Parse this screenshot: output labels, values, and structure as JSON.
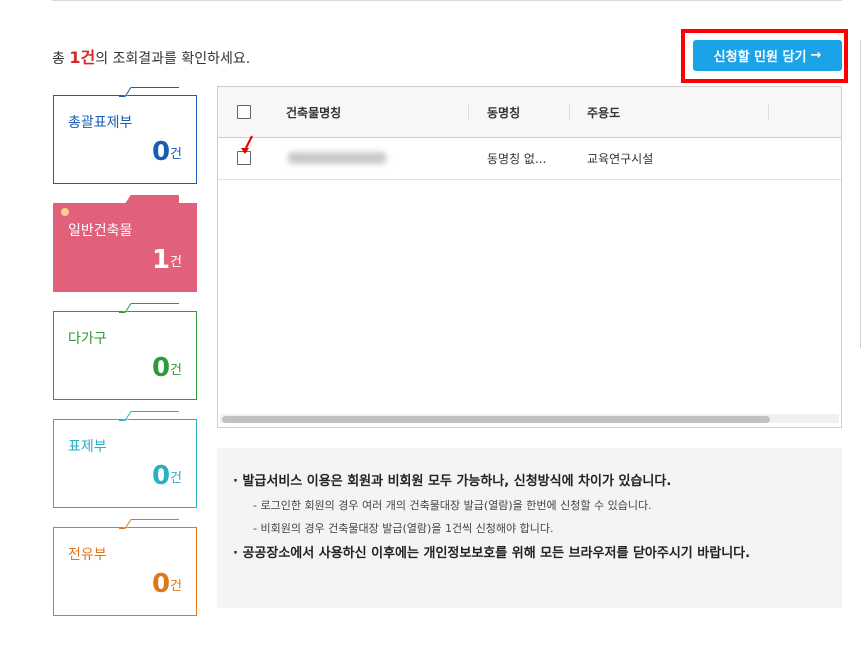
{
  "result": {
    "prefix": "총",
    "count": "1건",
    "suffix": "의 조회결과를 확인하세요."
  },
  "apply_button": {
    "label": "신청할 민원 담기",
    "arrow": "→"
  },
  "categories": [
    {
      "label": "총괄표제부",
      "count": "0",
      "unit": "건",
      "color": "#1a5db4",
      "selected": false
    },
    {
      "label": "일반건축물",
      "count": "1",
      "unit": "건",
      "color": "#e06179",
      "selected": true
    },
    {
      "label": "다가구",
      "count": "0",
      "unit": "건",
      "color": "#2e9a3a",
      "selected": false
    },
    {
      "label": "표제부",
      "count": "0",
      "unit": "건",
      "color": "#2ab0c0",
      "selected": false
    },
    {
      "label": "전유부",
      "count": "0",
      "unit": "건",
      "color": "#e0781a",
      "selected": false
    }
  ],
  "table": {
    "headers": [
      "건축물명칭",
      "동명칭",
      "주용도"
    ],
    "rows": [
      {
        "name": "",
        "dong": "동명칭 없...",
        "use": "교육연구시설"
      }
    ]
  },
  "notice": {
    "main1": "· 발급서비스 이용은 회원과 비회원 모두 가능하나, 신청방식에 차이가 있습니다.",
    "sub1": "- 로그인한 회원의 경우 여러 개의 건축물대장 발급(열람)을 한번에 신청할 수 있습니다.",
    "sub2": "- 비회원의 경우 건축물대장 발급(열람)을 1건씩 신청해야 합니다.",
    "main2": "· 공공장소에서 사용하신 이후에는 개인정보보호를 위해 모든 브라우저를 닫아주시기 바랍니다."
  },
  "colors": {
    "accent": "#1ba3e8",
    "highlight_box": "#ff0000",
    "count_red": "#d42a2a"
  }
}
